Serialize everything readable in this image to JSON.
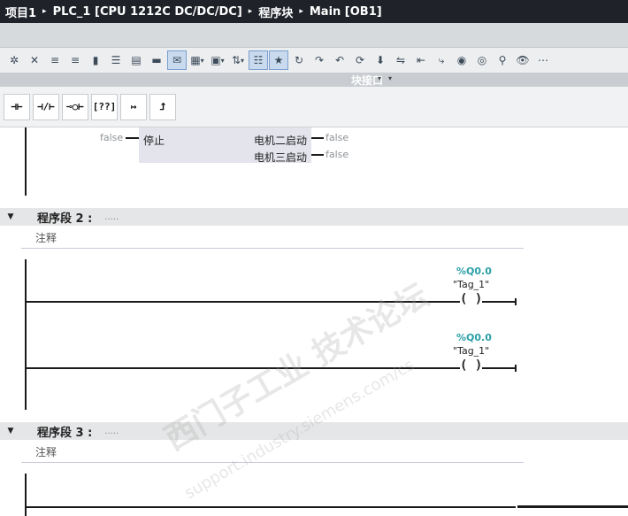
{
  "breadcrumb": {
    "items": [
      "项目1",
      "PLC_1 [CPU 1212C DC/DC/DC]",
      "程序块",
      "Main [OB1]"
    ],
    "separator": "▸"
  },
  "interface_bar": {
    "label": "块接口"
  },
  "ladder_toolbar": {
    "items": [
      "⊣⊢",
      "⊣/⊢",
      "⊸○⊢",
      "[??]",
      "↦",
      "⮥"
    ]
  },
  "network1": {
    "input_value": "false",
    "input_pin": "停止",
    "outputs": [
      {
        "label": "电机二启动",
        "value": "false"
      },
      {
        "label": "电机三启动",
        "value": "false"
      }
    ]
  },
  "network2": {
    "title": "程序段 2 :",
    "dots": ".....",
    "comment": "注释",
    "rungs": [
      {
        "address": "%Q0.0",
        "tag": "\"Tag_1\"",
        "coil": "( )"
      },
      {
        "address": "%Q0.0",
        "tag": "\"Tag_1\"",
        "coil": "( )"
      }
    ]
  },
  "network3": {
    "title": "程序段 3 :",
    "dots": ".....",
    "comment": "注释"
  },
  "watermark": {
    "cn": "西门子工业 技术论坛",
    "url": "support.industry.siemens.com/cs"
  },
  "colors": {
    "titlebar": "#1f2329",
    "tag_address": "#2a9fa6",
    "fb_block": "#e3e4ec"
  }
}
